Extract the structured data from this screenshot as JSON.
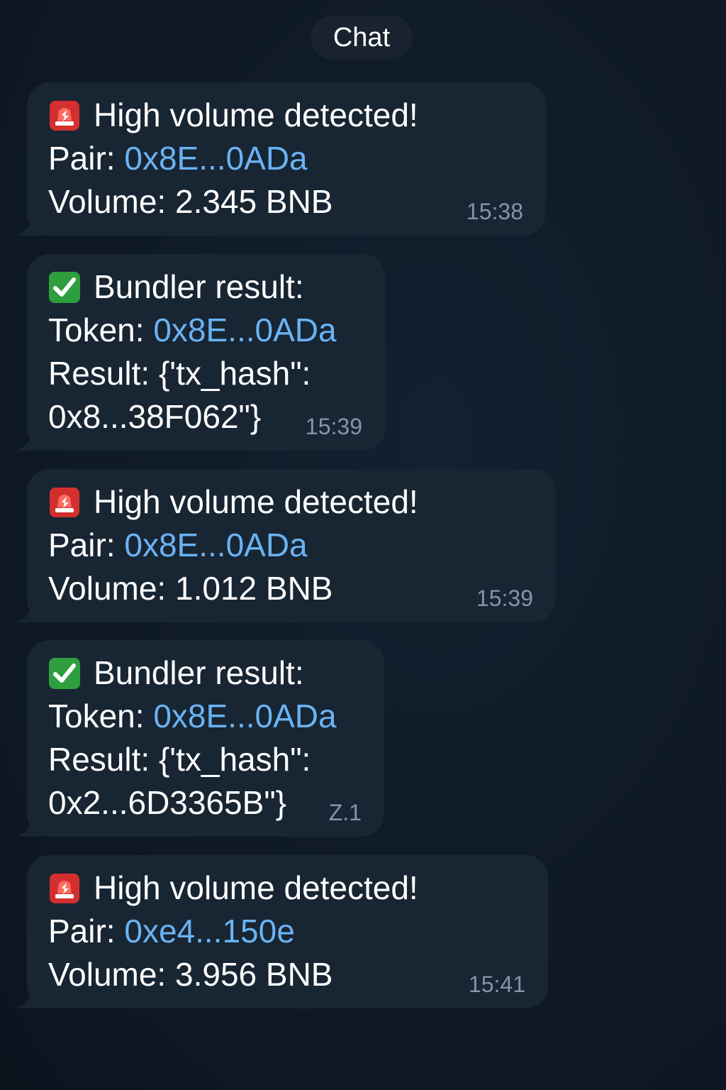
{
  "header": {
    "title": "Chat"
  },
  "messages": [
    {
      "title": "High volume detected!",
      "label": "Pair:",
      "address": "0x8E...0ADa",
      "line3": "Volume: 2.345 BNB",
      "time": "15:38",
      "icon": "siren-icon"
    },
    {
      "title": "Bundler result:",
      "label": "Token:",
      "address": "0x8E...0ADa",
      "line3": "Result: {'tx_hash\":",
      "line4": "0x8...38F062\"}",
      "time": "15:39",
      "icon": "check-icon"
    },
    {
      "title": "High volume detected!",
      "label": "Pair:",
      "address": "0x8E...0ADa",
      "line3": "Volume: 1.012 BNB",
      "time": "15:39",
      "icon": "siren-icon"
    },
    {
      "title": "Bundler result:",
      "label": "Token:",
      "address": "0x8E...0ADa",
      "line3": "Result: {'tx_hash\":",
      "line4": "0x2...6D3365B\"}",
      "time": "Z.1",
      "icon": "check-icon"
    },
    {
      "title": "High volume detected!",
      "label": "Pair:",
      "address": "0xe4...150e",
      "line3": "Volume: 3.956 BNB",
      "time": "15:41",
      "icon": "siren-icon"
    }
  ],
  "colors": {
    "background": "#0e1621",
    "bubble": "#182533",
    "link": "#6ab3f3",
    "time": "#8495a8",
    "siren": "#e53935",
    "check": "#43a047"
  }
}
